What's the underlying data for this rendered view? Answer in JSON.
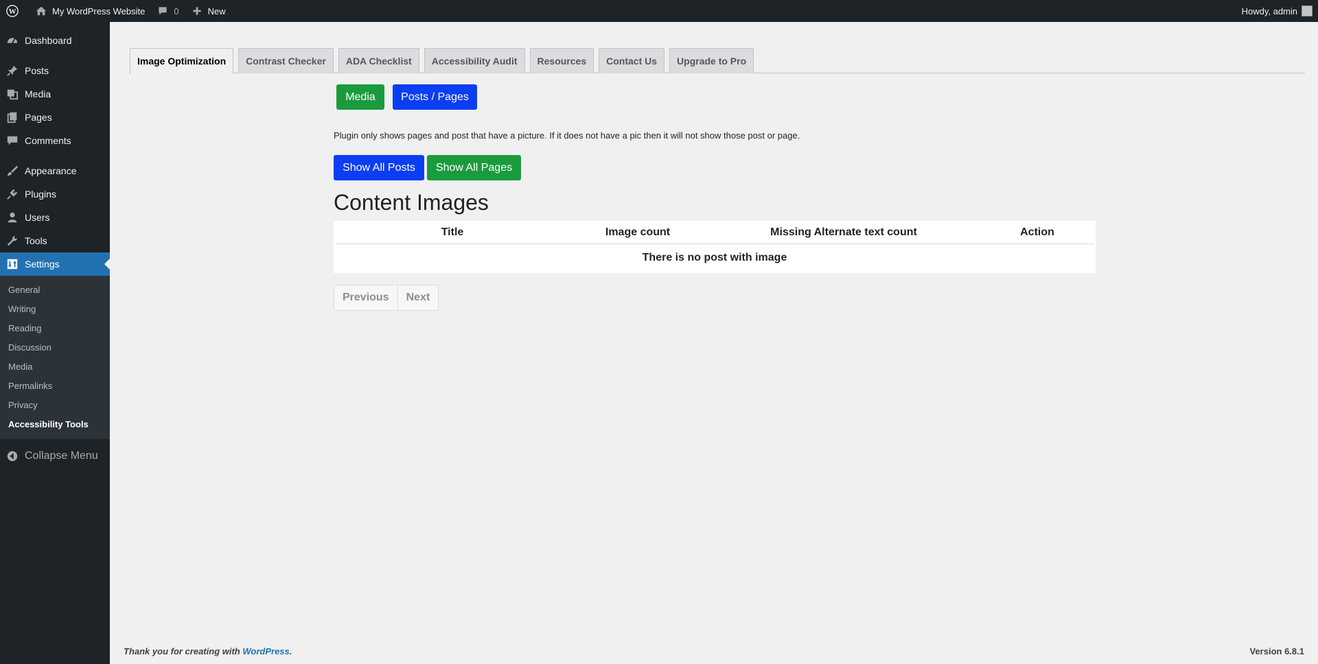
{
  "adminbar": {
    "site_name": "My WordPress Website",
    "comments_count": "0",
    "new_label": "New",
    "howdy": "Howdy, admin"
  },
  "sidebar": {
    "items": [
      {
        "label": "Dashboard",
        "icon": "dashboard-icon"
      },
      {
        "label": "Posts",
        "icon": "pin-icon"
      },
      {
        "label": "Media",
        "icon": "media-icon"
      },
      {
        "label": "Pages",
        "icon": "pages-icon"
      },
      {
        "label": "Comments",
        "icon": "comment-icon"
      },
      {
        "label": "Appearance",
        "icon": "brush-icon"
      },
      {
        "label": "Plugins",
        "icon": "plug-icon"
      },
      {
        "label": "Users",
        "icon": "user-icon"
      },
      {
        "label": "Tools",
        "icon": "wrench-icon"
      },
      {
        "label": "Settings",
        "icon": "settings-icon"
      }
    ],
    "submenu": [
      "General",
      "Writing",
      "Reading",
      "Discussion",
      "Media",
      "Permalinks",
      "Privacy",
      "Accessibility Tools"
    ],
    "collapse_label": "Collapse Menu"
  },
  "tabs": [
    "Image Optimization",
    "Contrast Checker",
    "ADA Checklist",
    "Accessibility Audit",
    "Resources",
    "Contact Us",
    "Upgrade to Pro"
  ],
  "buttons": {
    "media": "Media",
    "posts_pages": "Posts / Pages",
    "show_all_posts": "Show All Posts",
    "show_all_pages": "Show All Pages"
  },
  "note": "Plugin only shows pages and post that have a picture. If it does not have a pic then it will not show those post or page.",
  "heading": "Content Images",
  "table": {
    "columns": [
      "Title",
      "Image count",
      "Missing Alternate text count",
      "Action"
    ],
    "empty_message": "There is no post with image"
  },
  "pager": {
    "previous": "Previous",
    "next": "Next"
  },
  "footer": {
    "thanks_prefix": "Thank you for creating with ",
    "link": "WordPress",
    "suffix": ".",
    "version": "Version 6.8.1"
  },
  "colors": {
    "admin_dark": "#1d2327",
    "accent_blue": "#2271b1",
    "button_green": "#1a9c3e",
    "button_blue": "#0b3df2"
  }
}
